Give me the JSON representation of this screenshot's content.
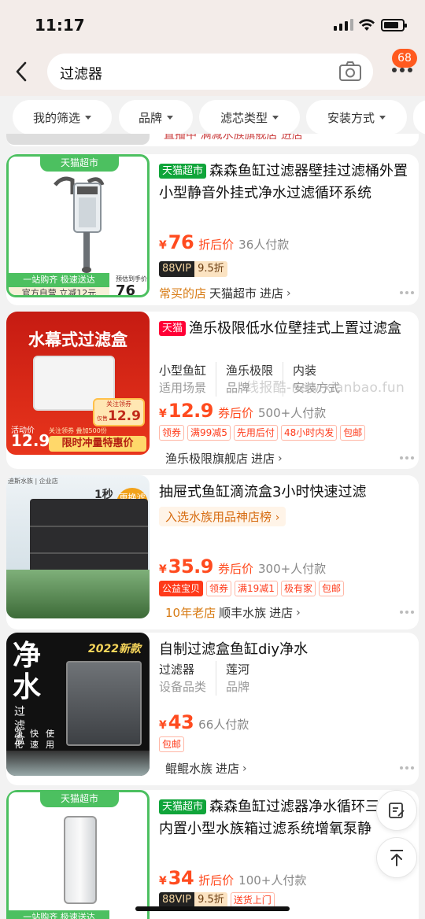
{
  "status_bar": {
    "time": "11:17"
  },
  "search": {
    "query": "过滤器",
    "message_count": "68"
  },
  "filters": [
    "我的筛选",
    "品牌",
    "滤芯类型",
    "安装方式"
  ],
  "products": [
    {
      "badge": "天猫超市",
      "title": "森森鱼缸过滤器壁挂过滤桶外置小型静音外挂式净水过滤循环系统",
      "price": "76",
      "price_suffix": "折后价",
      "sold": "36人付款",
      "vip_label": "88VIP",
      "vip_discount": "9.5折",
      "shop_label": "常买的店",
      "shop": "天猫超市",
      "enter": "进店",
      "image_top_banner": "天猫超市",
      "image_promo_1": "一站购齐 极速送达",
      "image_promo_2": "官方自营 立减12元",
      "image_price_note": "预估到手价",
      "image_price": "76起"
    },
    {
      "badge": "天猫",
      "title": "渔乐极限低水位壁挂式上置过滤盒",
      "attributes": [
        {
          "value": "小型鱼缸",
          "key": "适用场景"
        },
        {
          "value": "渔乐极限",
          "key": "品牌"
        },
        {
          "value": "内装",
          "key": "安装方式"
        }
      ],
      "price": "12.9",
      "price_suffix": "券后价",
      "sold": "500+人付款",
      "services": [
        "领券",
        "满99减5",
        "先用后付",
        "48小时内发",
        "包邮"
      ],
      "shop": "渔乐极限旗舰店",
      "enter": "进店",
      "image_headline": "水幕式过滤盒",
      "image_tag_top": "关注领券",
      "image_tag_price": "12.9",
      "image_tag_note": "仅售",
      "image_activity": "活动价",
      "image_price": "12.9",
      "image_follow": "关注领券 叠加500份",
      "image_slogan": "限时冲量特惠价"
    },
    {
      "title": "抽屉式鱼缸滴流盒3小时快速过滤",
      "rank": "入选水族用品神店榜",
      "price": "35.9",
      "price_suffix": "券后价",
      "sold": "300+人付款",
      "services": [
        "公益宝贝",
        "领券",
        "满19减1",
        "极有家",
        "包邮"
      ],
      "shop_label": "10年老店",
      "shop": "顺丰水族",
      "enter": "进店",
      "image_corner": "迪斯水族 | 企业店",
      "image_time": "1秒",
      "image_badge": "更换滤材"
    },
    {
      "title": "自制过滤盒鱼缸diy净水",
      "attributes": [
        {
          "value": "过滤器",
          "key": "设备品类"
        },
        {
          "value": "莲河",
          "key": "品牌"
        }
      ],
      "price": "43",
      "sold": "66人付款",
      "services": [
        "包邮"
      ],
      "shop": "鲲鲲水族",
      "enter": "进店",
      "image_year": "2022新款",
      "image_big": "净水",
      "image_sub": "过滤盒",
      "image_feat_1": "净化水质",
      "image_feat_2": "快速培菌",
      "image_feat_3": "使用方便"
    },
    {
      "badge": "天猫超市",
      "title": "森森鱼缸过滤器净水循环三合一内置小型水族箱过滤系统增氧泵静",
      "price": "34",
      "price_suffix": "折后价",
      "sold": "100+人付款",
      "vip_label": "88VIP",
      "vip_discount": "9.5折",
      "services": [
        "送货上门"
      ],
      "image_top_banner": "天猫超市",
      "image_promo_1": "一站购齐 极速送达"
    }
  ],
  "peek_top": "直播中 满减水族旗舰店 进店",
  "watermark": "线报酷-new.xianbao.fun",
  "colors": {
    "accent": "#ff4b1f",
    "tmall_green": "#10a53a",
    "tmall_red": "#ff0036"
  }
}
